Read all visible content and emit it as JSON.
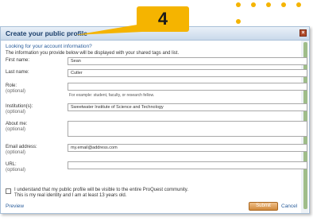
{
  "dialog": {
    "title": "Create your public profile",
    "close_label": "×",
    "account_link": "Looking for your account information?",
    "intro": "The information you provide below will be displayed with your shared tags and list.",
    "fields": [
      {
        "label": "First name:",
        "optional": "",
        "value": "Sean",
        "hint": ""
      },
      {
        "label": "Last name:",
        "optional": "",
        "value": "Cutler",
        "hint": ""
      },
      {
        "label": "Role:",
        "optional": "(optional)",
        "value": "",
        "hint": "For example: student, faculty, or research fellow."
      },
      {
        "label": "Institution(s):",
        "optional": "(optional)",
        "value": "Sweetwater Institute of Science and Technology",
        "hint": ""
      },
      {
        "label": "About me:",
        "optional": "(optional)",
        "value": "",
        "hint": ""
      },
      {
        "label": "Email address:",
        "optional": "(optional)",
        "value": "my.email@address.com",
        "hint": ""
      },
      {
        "label": "URL:",
        "optional": "(optional)",
        "value": "",
        "hint": ""
      }
    ],
    "consent_line1": "I understand that my public profile will be visible to the entire ProQuest community.",
    "consent_line2": "This is my real identity and I am at least 13 years old.",
    "preview_link": "Preview",
    "submit_label": "Submit",
    "cancel_link": "Cancel"
  },
  "callout": {
    "number": "4",
    "color": "#f5b400"
  },
  "colors": {
    "title_text": "#1b3f6b",
    "link": "#2a5d9b",
    "submit": "#d18a3c",
    "scroll_thumb": "#9fbd8a"
  }
}
